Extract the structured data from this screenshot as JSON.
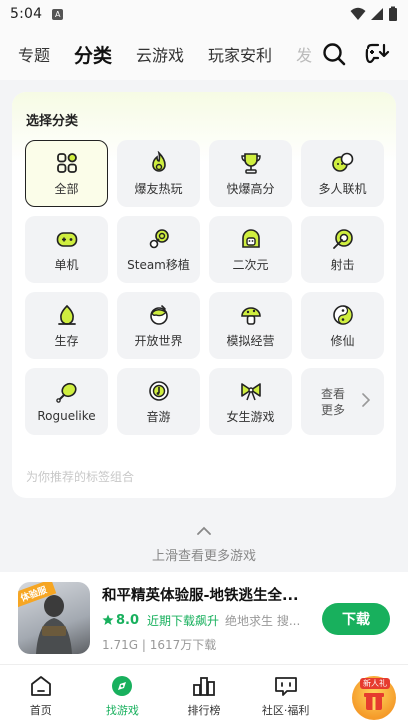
{
  "status_bar": {
    "time": "5:04",
    "notification_icon": "A"
  },
  "top_nav": {
    "tabs": [
      {
        "label": "专题"
      },
      {
        "label": "分类"
      },
      {
        "label": "云游戏"
      },
      {
        "label": "玩家安利"
      },
      {
        "label": "发"
      }
    ],
    "active_index": 1,
    "icons": [
      "search-icon",
      "gamepad-download-icon"
    ]
  },
  "category_panel": {
    "title": "选择分类",
    "categories": [
      {
        "label": "全部",
        "icon": "grid-icon"
      },
      {
        "label": "爆友热玩",
        "icon": "fire-icon"
      },
      {
        "label": "快爆高分",
        "icon": "trophy-icon"
      },
      {
        "label": "多人联机",
        "icon": "multiplayer-icon"
      },
      {
        "label": "单机",
        "icon": "gamepad-icon"
      },
      {
        "label": "Steam移植",
        "icon": "steam-icon"
      },
      {
        "label": "二次元",
        "icon": "anime-icon"
      },
      {
        "label": "射击",
        "icon": "target-icon"
      },
      {
        "label": "生存",
        "icon": "campfire-icon"
      },
      {
        "label": "开放世界",
        "icon": "globe-icon"
      },
      {
        "label": "模拟经营",
        "icon": "mushroom-icon"
      },
      {
        "label": "修仙",
        "icon": "yin-yang-icon"
      },
      {
        "label": "Roguelike",
        "icon": "meat-icon"
      },
      {
        "label": "音游",
        "icon": "music-icon"
      },
      {
        "label": "女生游戏",
        "icon": "bow-icon"
      }
    ],
    "selected_index": 0,
    "more": {
      "line1": "查看",
      "line2": "更多"
    },
    "faded_heading": "为你推荐的标签组合"
  },
  "swipe_hint": {
    "text": "上滑查看更多游戏"
  },
  "game_card": {
    "title": "和平精英体验服-地铁逃生全...",
    "badge": "体验服",
    "score": "8.0",
    "tag": "近期下载飙升",
    "sub_tags": "绝地求生  搜...",
    "size": "1.71G",
    "downloads": "1617万下载",
    "download_button": "下载"
  },
  "bottom_nav": {
    "items": [
      {
        "label": "首页",
        "icon": "home-icon"
      },
      {
        "label": "找游戏",
        "icon": "find-game-icon"
      },
      {
        "label": "排行榜",
        "icon": "ranking-icon"
      },
      {
        "label": "社区·福利",
        "icon": "community-icon"
      }
    ],
    "active_index": 1,
    "gift_badge": "新人礼"
  },
  "colors": {
    "accent_green": "#18b05d",
    "highlight_yellow": "#cfee3f"
  }
}
